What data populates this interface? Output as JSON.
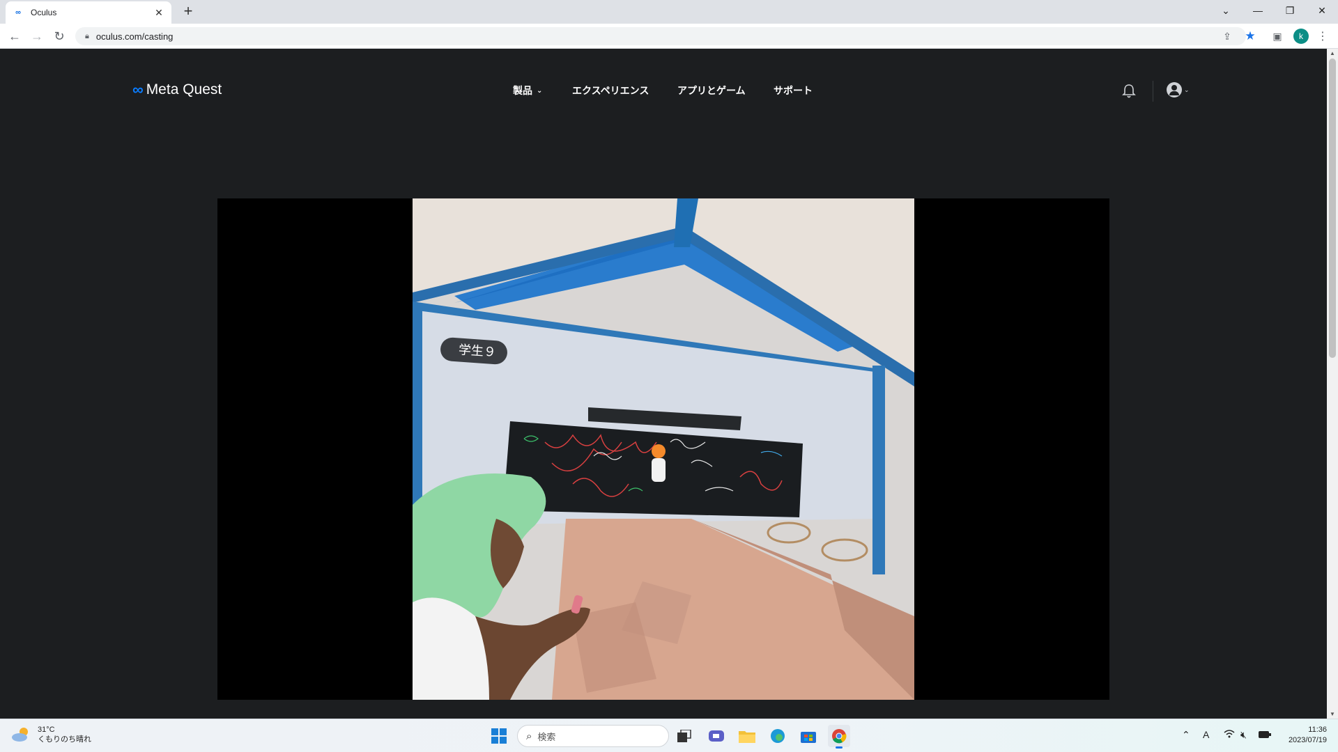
{
  "browser": {
    "tab": {
      "title": "Oculus",
      "favicon": "meta-logo-icon"
    },
    "url": "oculus.com/casting",
    "profile_initial": "k"
  },
  "site": {
    "logo_text": "Meta Quest",
    "nav": [
      {
        "label": "製品",
        "has_dropdown": true
      },
      {
        "label": "エクスペリエンス"
      },
      {
        "label": "アプリとゲーム"
      },
      {
        "label": "サポート"
      }
    ]
  },
  "cast": {
    "name_tag": "学生９"
  },
  "taskbar": {
    "weather_temp": "31°C",
    "weather_desc": "くもりのち晴れ",
    "search_placeholder": "検索",
    "time": "11:36",
    "date": "2023/07/19"
  },
  "colors": {
    "page_bg": "#1c1e20",
    "brand_blue": "#0a7cff",
    "profile": "#0b8e86"
  }
}
